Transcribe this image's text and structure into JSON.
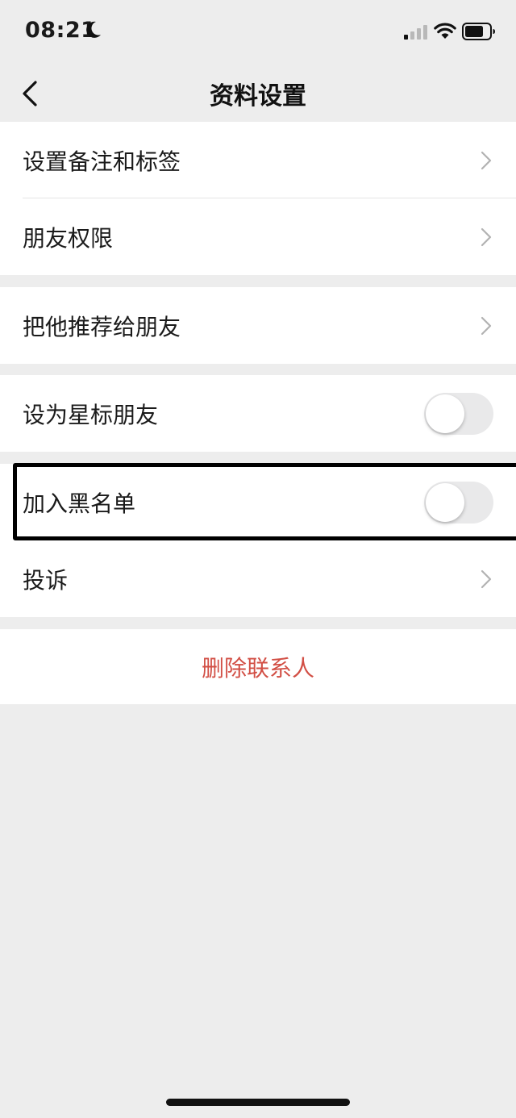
{
  "status_bar": {
    "time": "08:21",
    "icons": [
      "moon-icon",
      "cellular-signal-icon",
      "wifi-icon",
      "battery-icon"
    ]
  },
  "nav": {
    "title": "资料设置",
    "back_icon": "chevron-left-icon"
  },
  "groups": [
    {
      "items": [
        {
          "label": "设置备注和标签",
          "type": "chevron"
        },
        {
          "label": "朋友权限",
          "type": "chevron"
        }
      ]
    },
    {
      "items": [
        {
          "label": "把他推荐给朋友",
          "type": "chevron"
        }
      ]
    },
    {
      "items": [
        {
          "label": "设为星标朋友",
          "type": "toggle",
          "on": false
        }
      ]
    },
    {
      "items": [
        {
          "label": "加入黑名单",
          "type": "toggle",
          "on": false,
          "highlighted": true
        },
        {
          "label": "投诉",
          "type": "chevron"
        }
      ]
    }
  ],
  "delete_contact": {
    "label": "删除联系人",
    "color": "#d24f45"
  },
  "colors": {
    "background": "#ededed",
    "card": "#ffffff",
    "toggle_off": "#e9e9ea",
    "highlight_border": "#000000"
  }
}
